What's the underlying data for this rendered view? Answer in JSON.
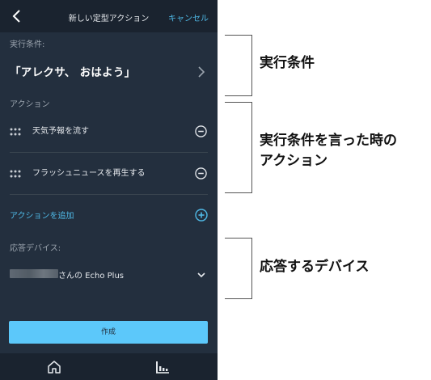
{
  "header": {
    "title": "新しい定型アクション",
    "cancel_label": "キャンセル"
  },
  "trigger": {
    "section_label": "実行条件:",
    "phrase": "「アレクサ、 おはよう」"
  },
  "actions": {
    "section_label": "アクション",
    "items": [
      {
        "label": "天気予報を流す"
      },
      {
        "label": "フラッシュニュースを再生する"
      }
    ],
    "add_label": "アクションを追加"
  },
  "device": {
    "section_label": "応答デバイス:",
    "name": "さんの Echo Plus"
  },
  "create_label": "作成",
  "annotations": {
    "trigger": "実行条件",
    "actions_line1": "実行条件を言った時の",
    "actions_line2": "アクション",
    "device": "応答するデバイス"
  },
  "colors": {
    "background": "#232f3e",
    "bar": "#1a232f",
    "accent": "#4fb9e6",
    "button": "#5cc8fa"
  },
  "icons": {
    "back": "chevron-left-icon",
    "trigger_nav": "chevron-right-icon",
    "drag": "drag-grip-icon",
    "remove": "minus-circle-icon",
    "add": "plus-circle-icon",
    "device_select": "chevron-down-icon",
    "home": "home-icon",
    "activity": "activity-icon"
  }
}
